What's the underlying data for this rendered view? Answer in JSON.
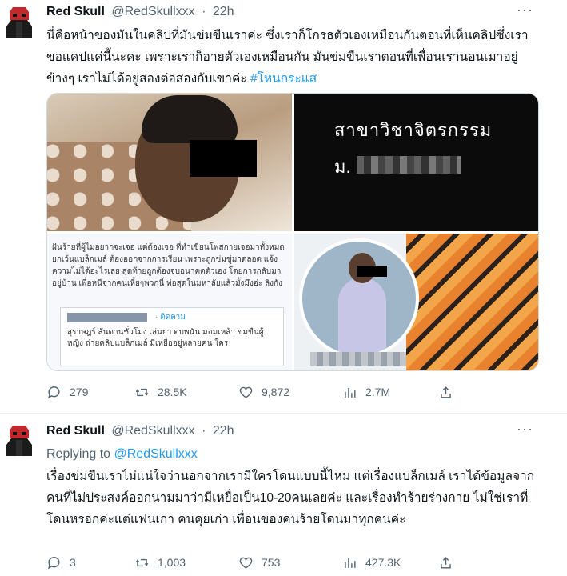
{
  "tweets": [
    {
      "author": {
        "name": "Red Skull",
        "handle": "@RedSkullxxx",
        "time": "22h"
      },
      "text": "นี่คือหน้าของมันในคลิปที่มันข่มขืนเราค่ะ ซึ่งเราก็โกรธตัวเองเหมือนกันตอนที่เห็นคลิปซึ่งเราขอแคปแค่นี้นะคะ เพราะเราก็อายตัวเองเหมือนกัน มันข่มขืนเราตอนที่เพื่อนเรานอนเมาอยู่ข้างๆ เราไม่ได้อยู่สองต่อสองกับเขาค่ะ",
      "hashtag": "#โหนกระแส",
      "media": {
        "image2_line1": "สาขาวิชาจิตรกรรม",
        "image2_line2": "ม.",
        "image3_text": "ฝันร้ายที่ผู้ไม่อยากจะเจอ แต่ต้องเจอ ที่ทำเขียนโพสกายเจอมาทั้งหมด ยกเว้นแบล็กเมล์ ต้องออกจากการเรียน เพราะถูกข่มขู่มาตลอด แจ้งความไม่ได้อะไรเลย สุดท้ายถูกต้องจบอนาคตตัวเอง โดยการกลับมาอยู่บ้าน เพื่อหนีจากคนเหี้ยๆพวกนี้ ท่อสุดในมหาลัยแล้วมั้งมึงอ่ะ ลิงกัง",
        "image3_card_follow": "· ติดตาม",
        "image3_card_snippet": "สุราษฎร์ สันดานชั่วโมง เล่นยา ตบพนัน มอมเหล้า ข่มขืนผู้หญิง ถ่ายคลิปแบล็กเมล์ มีเหยื่ออยู่หลายคน ใคร"
      },
      "stats": {
        "replies": "279",
        "retweets": "28.5K",
        "likes": "9,872",
        "views": "2.7M"
      }
    },
    {
      "author": {
        "name": "Red Skull",
        "handle": "@RedSkullxxx",
        "time": "22h"
      },
      "replying_label": "Replying to",
      "replying_handle": "@RedSkullxxx",
      "text": "เรื่องข่มขืนเราไม่แน่ใจว่านอกจากเรามีใครโดนแบบนี้ไหม แต่เรื่องแบล็กเมล์ เราได้ข้อมูลจากคนที่ไม่ประสงค์ออกนามมาว่ามีเหยื่อเป็น10-20คนเลยค่ะ และเรื่องทำร้ายร่างกาย ไม่ใช่เราที่โดนหรอกค่ะแต่แฟนเก่า คนคุยเก่า เพื่อนของคนร้ายโดนมาทุกคนค่ะ",
      "stats": {
        "replies": "3",
        "retweets": "1,003",
        "likes": "753",
        "views": "427.3K"
      }
    }
  ],
  "icons": {
    "avatar": "red-skull-avatar",
    "more": "more-icon",
    "reply": "reply-icon",
    "retweet": "retweet-icon",
    "like": "like-icon",
    "views": "views-icon",
    "share": "share-icon"
  },
  "colors": {
    "link": "#1d9bf0",
    "secondary_text": "#536471",
    "avatar_red": "#c0282b"
  }
}
